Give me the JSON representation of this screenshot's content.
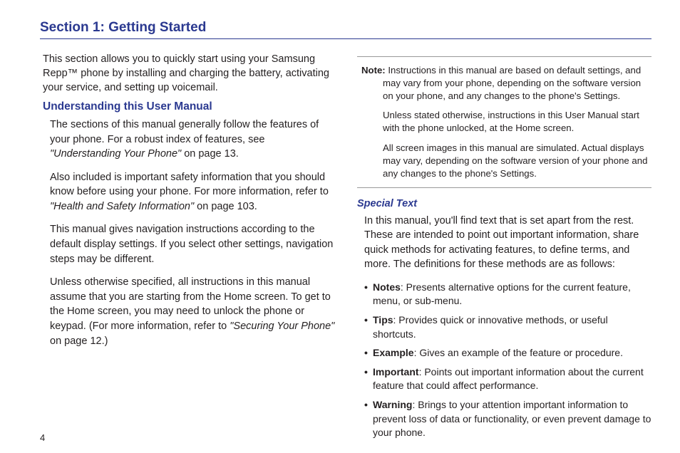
{
  "sectionTitle": "Section 1: Getting Started",
  "leftCol": {
    "intro": "This section allows you to quickly start using your Samsung Repp™ phone by installing and charging the battery, activating your service, and setting up voicemail.",
    "subheading": "Understanding this User Manual",
    "p1_a": "The sections of this manual generally follow the features of your phone. For a robust index of features, see ",
    "p1_ref": "\"Understanding Your Phone\"",
    "p1_b": " on page 13.",
    "p2_a": "Also included is important safety information that you should know before using your phone. For more information, refer to ",
    "p2_ref": "\"Health and Safety Information\"",
    "p2_b": " on page 103.",
    "p3": "This manual gives navigation instructions according to the default display settings. If you select other settings, navigation steps may be different.",
    "p4_a": "Unless otherwise specified, all instructions in this manual assume that you are starting from the Home screen. To get to the Home screen, you may need to unlock the phone or keypad. (For more information, refer to ",
    "p4_ref": "\"Securing Your Phone\"",
    "p4_b": " on page 12.)"
  },
  "rightCol": {
    "noteLabel": "Note:",
    "note1": " Instructions in this manual are based on default settings, and may vary from your phone, depending on the software version on your phone, and any changes to the phone's Settings.",
    "note2": "Unless stated otherwise, instructions in this User Manual start with the phone unlocked, at the Home screen.",
    "note3": "All screen images in this manual are simulated. Actual displays may vary, depending on the software version of your phone and any changes to the phone's Settings.",
    "specialHeading": "Special Text",
    "specialIntro": "In this manual, you'll find text that is set apart from the rest. These are intended to point out important information, share quick methods for activating features, to define terms, and more. The definitions for these methods are as follows:",
    "bullets": [
      {
        "label": "Notes",
        "text": ": Presents alternative options for the current feature, menu, or sub-menu."
      },
      {
        "label": "Tips",
        "text": ": Provides quick or innovative methods, or useful shortcuts."
      },
      {
        "label": "Example",
        "text": ": Gives an example of the feature or procedure."
      },
      {
        "label": "Important",
        "text": ": Points out important information about the current feature that could affect performance."
      },
      {
        "label": "Warning",
        "text": ": Brings to your attention important information to prevent loss of data or functionality, or even prevent damage to your phone."
      }
    ]
  },
  "pageNum": "4"
}
